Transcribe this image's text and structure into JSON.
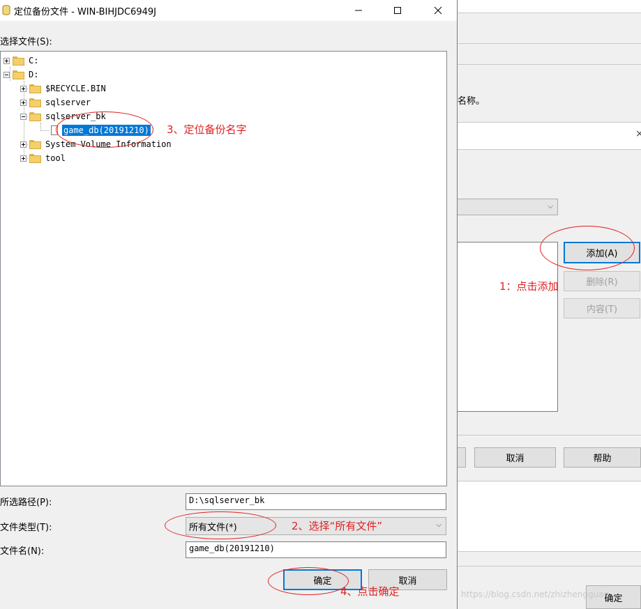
{
  "dialog": {
    "title": "定位备份文件 - WIN-BIHJDC6949J",
    "select_file_label": "选择文件(S):",
    "tree": {
      "drive_c": "C:",
      "drive_d": "D:",
      "recycle_bin": "$RECYCLE.BIN",
      "sqlserver": "sqlserver",
      "sqlserver_bk": "sqlserver_bk",
      "backup_file": "game_db(20191210)",
      "system_volume": "System Volume Information",
      "tool": "tool"
    },
    "path_label": "所选路径(P):",
    "path_value": "D:\\sqlserver_bk",
    "filetype_label": "文件类型(T):",
    "filetype_value": "所有文件(*)",
    "filename_label": "文件名(N):",
    "filename_value": "game_db(20191210)",
    "ok_label": "确定",
    "cancel_label": "取消"
  },
  "background_dialog": {
    "name_suffix": "名称。",
    "add_label": "添加(A)",
    "remove_label": "删除(R)",
    "contents_label": "内容(T)",
    "cancel_label": "取消",
    "help_label": "帮助",
    "ok_label": "确定"
  },
  "annotations": {
    "step1": "1：点击添加",
    "step2": "2、选择“所有文件”",
    "step3": "3、定位备份名字",
    "step4": "4、点击确定"
  },
  "watermark": "https://blog.csdn.net/zhizhengguan",
  "colors": {
    "annotation_red": "#e02020",
    "selection_blue": "#0078d7",
    "dialog_bg": "#f0f0f0"
  }
}
